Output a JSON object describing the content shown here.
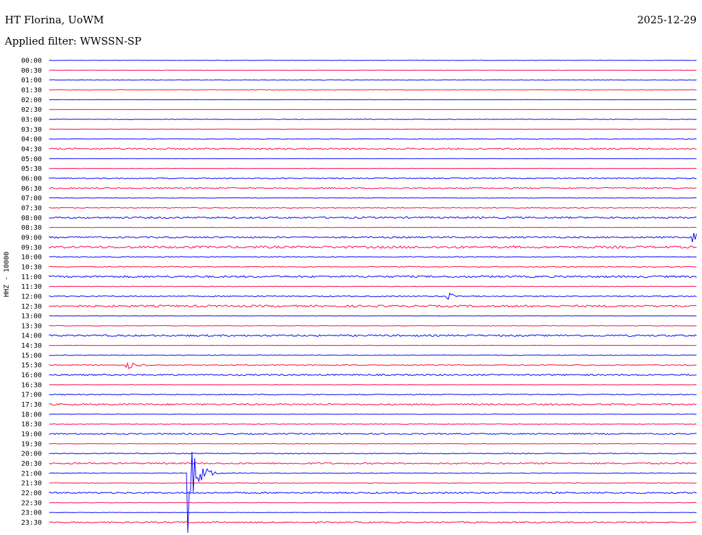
{
  "header": {
    "station": "HT Florina, UoWM",
    "date": "2025-12-29",
    "filter": "Applied filter: WWSSN-SP"
  },
  "channel_label": "HHZ - 10000",
  "colors": {
    "blue_trace": "#0000ff",
    "red_trace": "#ff0040"
  },
  "chart_data": {
    "type": "line",
    "title": "HT Florina, UoWM",
    "subtitle": "Applied filter: WWSSN-SP",
    "ylabel": "HHZ - 10000",
    "x": "time within 30-minute line",
    "categories": [
      "00:00",
      "00:30",
      "01:00",
      "01:30",
      "02:00",
      "02:30",
      "03:00",
      "03:30",
      "04:00",
      "04:30",
      "05:00",
      "05:30",
      "06:00",
      "06:30",
      "07:00",
      "07:30",
      "08:00",
      "08:30",
      "09:00",
      "09:30",
      "10:00",
      "10:30",
      "11:00",
      "11:30",
      "12:00",
      "12:30",
      "13:00",
      "13:30",
      "14:00",
      "14:30",
      "15:00",
      "15:30",
      "16:00",
      "16:30",
      "17:00",
      "17:30",
      "18:00",
      "18:30",
      "19:00",
      "19:30",
      "20:00",
      "20:30",
      "21:00",
      "21:30",
      "22:00",
      "22:30",
      "23:00",
      "23:30"
    ],
    "noise_level": [
      0.3,
      0.2,
      0.4,
      0.4,
      0.2,
      0.2,
      0.6,
      0.3,
      0.6,
      1.4,
      0.2,
      0.4,
      1.0,
      1.2,
      0.5,
      0.8,
      1.6,
      0.4,
      1.5,
      2.0,
      0.8,
      0.8,
      1.8,
      0.5,
      1.0,
      1.8,
      0.3,
      0.5,
      1.6,
      0.3,
      0.6,
      0.9,
      1.4,
      0.3,
      0.9,
      1.4,
      0.4,
      0.5,
      1.2,
      0.5,
      0.8,
      1.4,
      0.5,
      0.5,
      1.4,
      0.4,
      0.3,
      1.2
    ],
    "events": [
      {
        "line": "09:00",
        "time_fraction": 0.996,
        "amplitude": 8
      },
      {
        "line": "12:00",
        "time_fraction": 0.617,
        "amplitude": 6
      },
      {
        "line": "15:30",
        "time_fraction": 0.12,
        "amplitude": 9
      },
      {
        "line": "21:00",
        "time_fraction": 0.215,
        "amplitude": 95
      }
    ]
  }
}
